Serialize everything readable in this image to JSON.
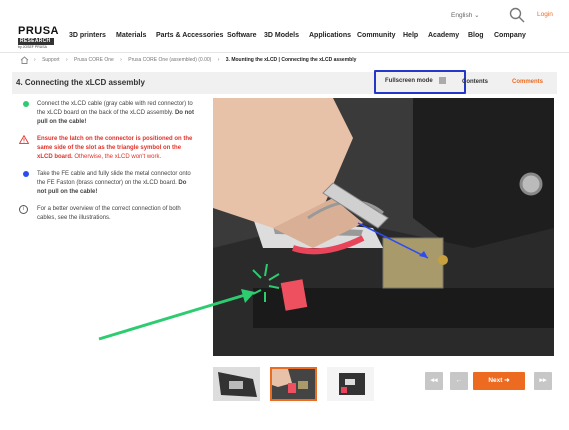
{
  "header": {
    "logo": {
      "top": "PRUSA",
      "mid": "RESEARCH",
      "bottom": "by JOSEF PRUSA"
    },
    "nav": [
      "3D printers",
      "Materials",
      "Parts & Accessories",
      "Software",
      "3D Models",
      "Applications",
      "Community",
      "Help",
      "Academy",
      "Blog",
      "Company"
    ],
    "language": "English ⌄",
    "login": "Login"
  },
  "breadcrumb": [
    "Support",
    "Prusa CORE One",
    "Prusa CORE One (assembled) (0.00)",
    "3. Mounting the xLCD | Connecting the xLCD assembly"
  ],
  "step": {
    "title": "4. Connecting the xLCD assembly",
    "fullscreen_label": "Fullscreen mode",
    "contents_label": "Contents",
    "comments_label": "Comments"
  },
  "instructions": {
    "item1_text": "Connect the xLCD cable (gray cable with red connector) to the xLCD board on the back of the xLCD assembly. ",
    "item1_bold": "Do not pull on the cable!",
    "warning_bold": "Ensure the latch on the connector is positioned on the same side of the slot as the triangle symbol on the xLCD board.",
    "warning_rest": " Otherwise, the xLCD won't work.",
    "item2_text": "Take the FE cable and fully slide the metal connector onto the FE Faston (brass connector) on the xLCD board. ",
    "item2_bold": "Do not pull on the cable!",
    "info_text": "For a better overview of the correct connection of both cables, see the illustrations."
  },
  "navigation": {
    "first": "◂◂",
    "prev": "←",
    "next": "Next ➜",
    "last": "▸▸"
  },
  "colors": {
    "accent": "#ed6b21",
    "green_bullet": "#2ecc71",
    "blue_bullet": "#2d4cf0",
    "warning": "#e0322a",
    "highlight_box": "#2337c9"
  }
}
